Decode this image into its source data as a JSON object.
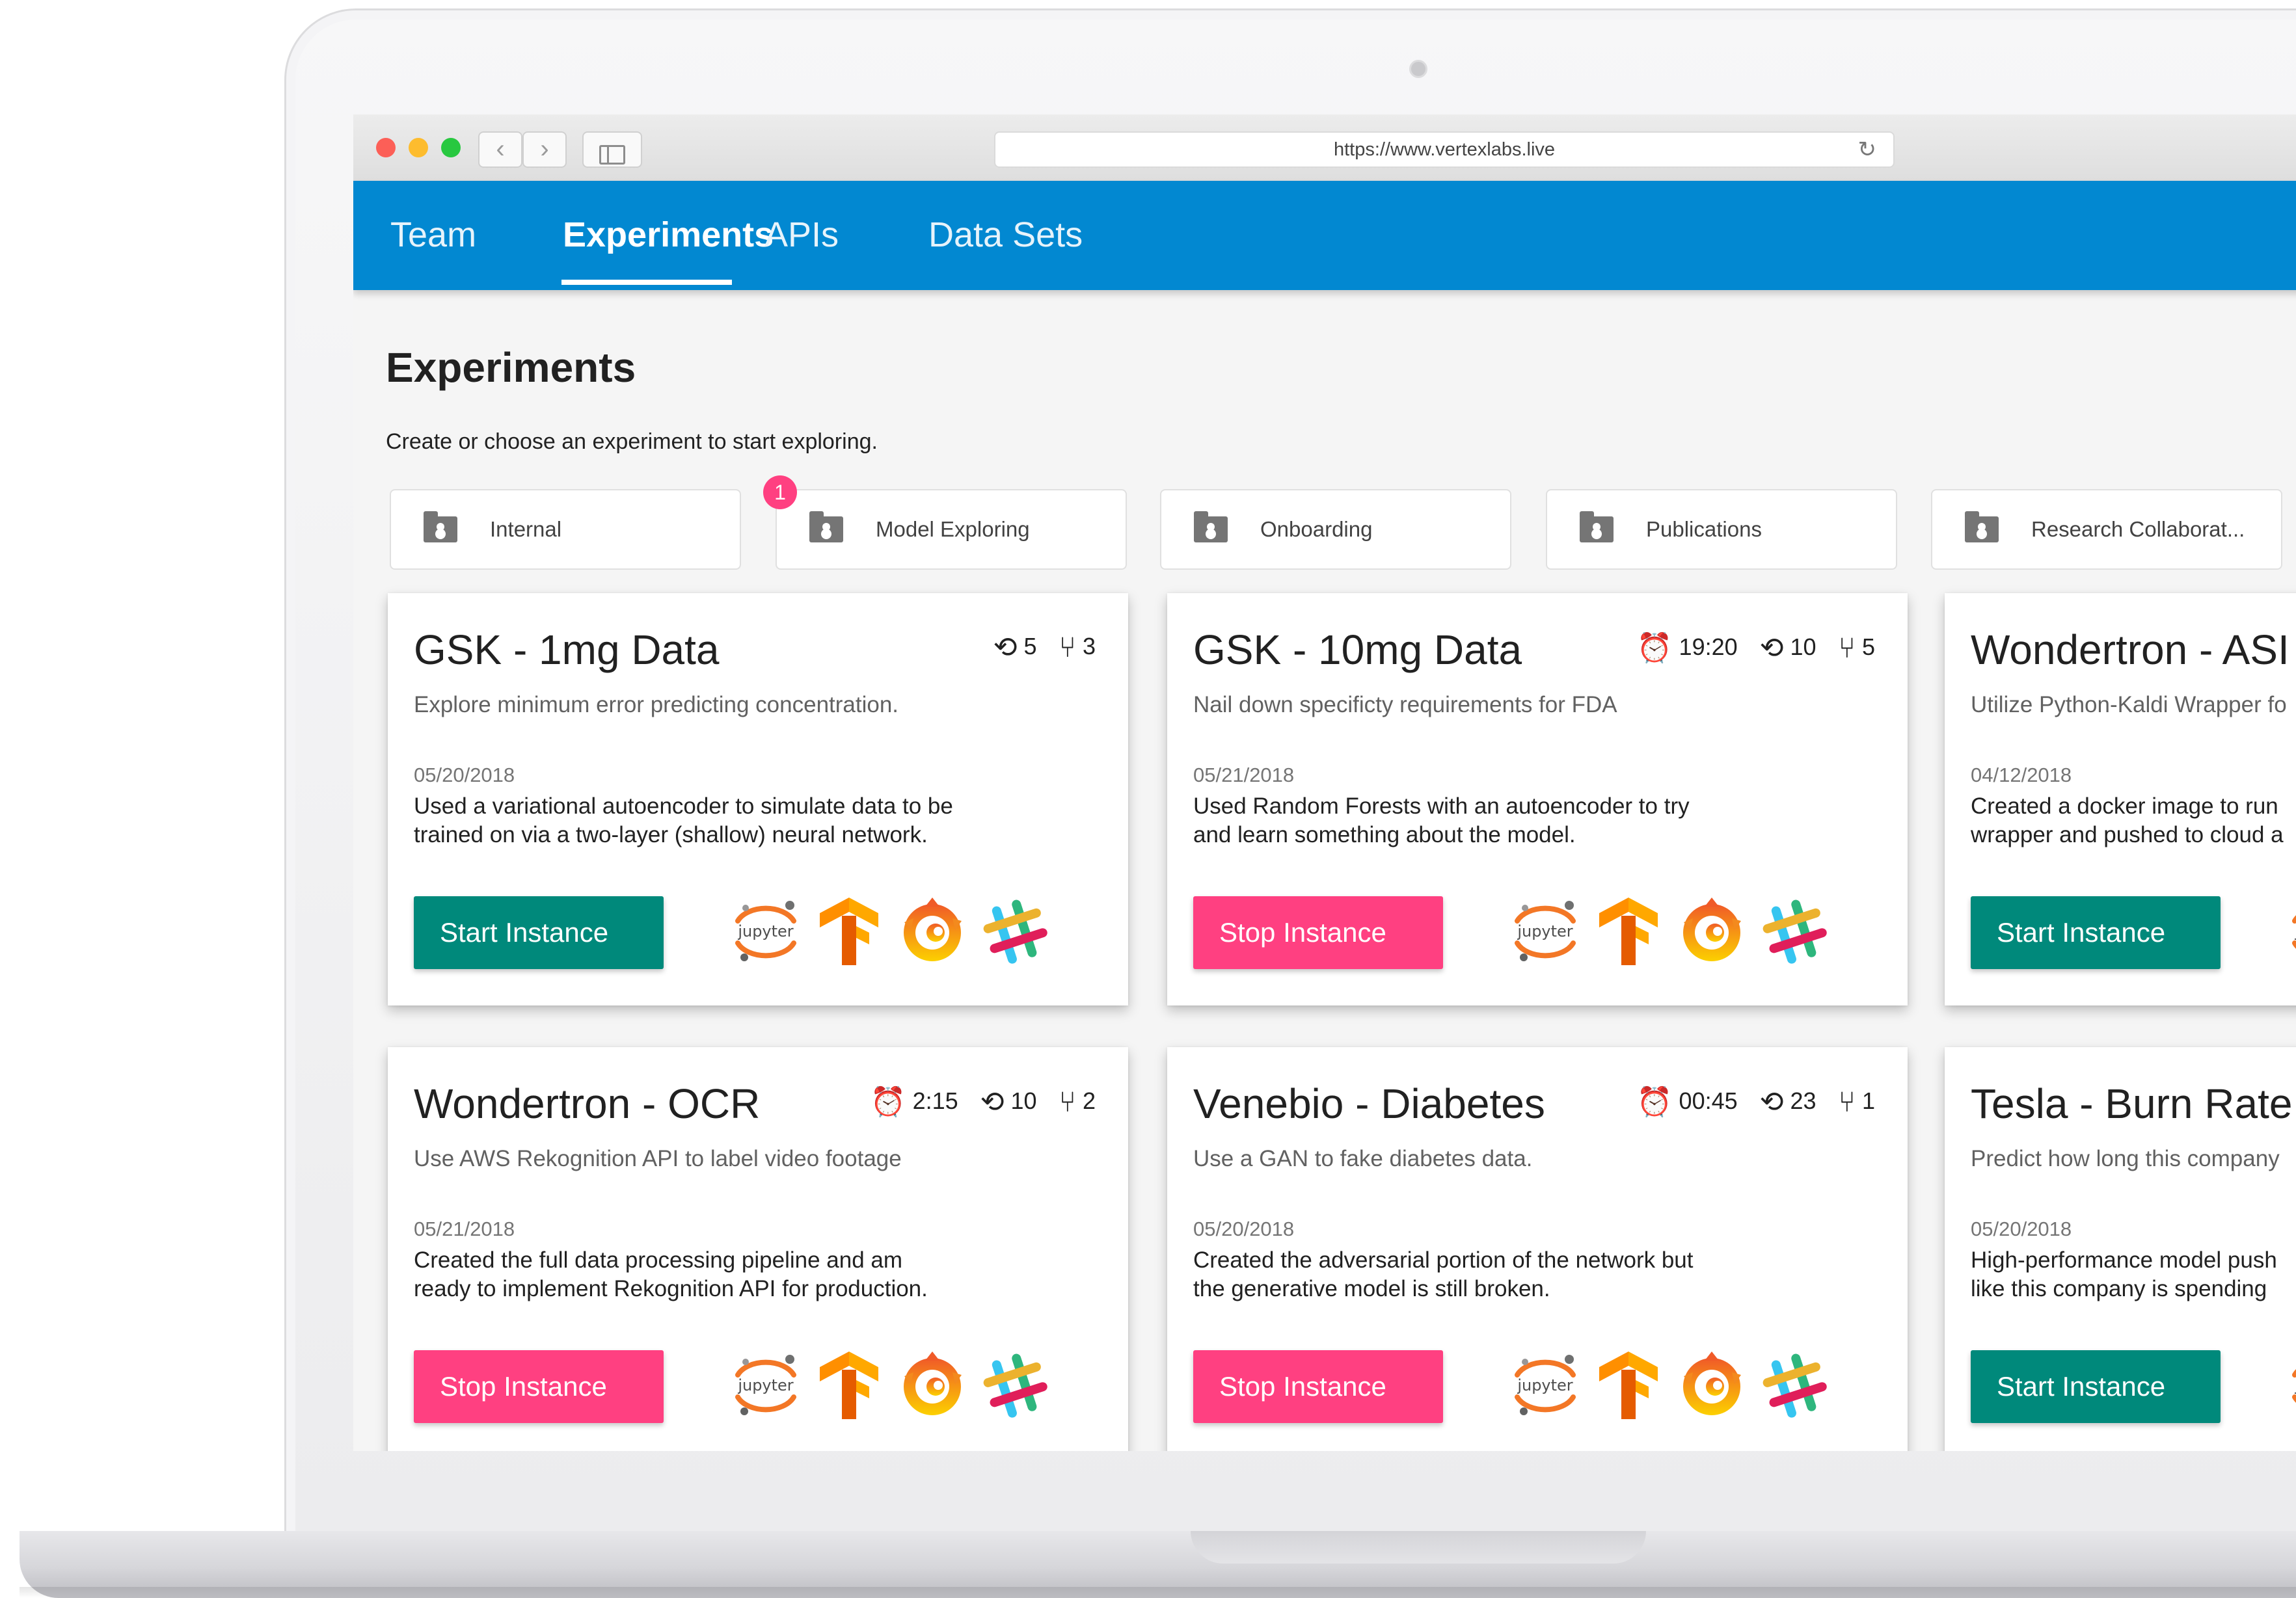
{
  "browser": {
    "url": "https://www.vertexlabs.live",
    "back_icon": "chevron-left-icon",
    "forward_icon": "chevron-right-icon",
    "reload_icon": "reload-icon"
  },
  "nav": {
    "tabs": [
      {
        "label": "Team"
      },
      {
        "label": "Experiments",
        "active": true
      },
      {
        "label": "APIs"
      },
      {
        "label": "Data Sets"
      }
    ]
  },
  "page": {
    "title": "Experiments",
    "subtitle": "Create or choose an experiment to start exploring."
  },
  "folders": [
    {
      "label": "Internal"
    },
    {
      "label": "Model Exploring",
      "badge": "1"
    },
    {
      "label": "Onboarding"
    },
    {
      "label": "Publications"
    },
    {
      "label": "Research Collaborat..."
    }
  ],
  "cards": [
    {
      "title": "GSK - 1mg Data",
      "time": "",
      "runs": "5",
      "branches": "3",
      "description": "Explore minimum error predicting concentration.",
      "date": "05/20/2018",
      "note_line1": "Used a variational autoencoder to simulate data to be",
      "note_line2": "trained on via a two-layer (shallow) neural network.",
      "action": "Start Instance"
    },
    {
      "title": "GSK - 10mg Data",
      "time": "19:20",
      "runs": "10",
      "branches": "5",
      "description": "Nail down specificty requirements for FDA",
      "date": "05/21/2018",
      "note_line1": "Used Random Forests with an autoencoder to try",
      "note_line2": "and learn something about the model.",
      "action": "Stop Instance"
    },
    {
      "title": "Wondertron - ASI",
      "time": "",
      "runs": "",
      "branches": "",
      "description": "Utilize Python-Kaldi Wrapper fo",
      "date": "04/12/2018",
      "note_line1": "Created a docker image to run",
      "note_line2": "wrapper and pushed to cloud a",
      "action": "Start Instance"
    },
    {
      "title": "Wondertron - OCR",
      "time": "2:15",
      "runs": "10",
      "branches": "2",
      "description": "Use AWS Rekognition API to label video footage",
      "date": "05/21/2018",
      "note_line1": "Created the full data processing pipeline and am",
      "note_line2": "ready to implement Rekognition API for production.",
      "action": "Stop Instance"
    },
    {
      "title": "Venebio - Diabetes",
      "time": "00:45",
      "runs": "23",
      "branches": "1",
      "description": "Use a GAN to fake diabetes data.",
      "date": "05/20/2018",
      "note_line1": "Created the adversarial portion of the network but",
      "note_line2": "the generative model is still broken.",
      "action": "Stop Instance"
    },
    {
      "title": "Tesla - Burn Rate",
      "time": "",
      "runs": "",
      "branches": "",
      "description": "Predict how long this company",
      "date": "05/20/2018",
      "note_line1": "High-performance model push",
      "note_line2": "like this company is spending",
      "action": "Start Instance"
    }
  ],
  "tool_icons": [
    "jupyter-icon",
    "tensorflow-icon",
    "grafana-icon",
    "slack-icon"
  ],
  "tool_labels": {
    "jupyter": "jupyter"
  },
  "colors": {
    "primary": "#0288d1",
    "start": "#00897b",
    "stop": "#ff4081",
    "badge": "#ff4081"
  }
}
